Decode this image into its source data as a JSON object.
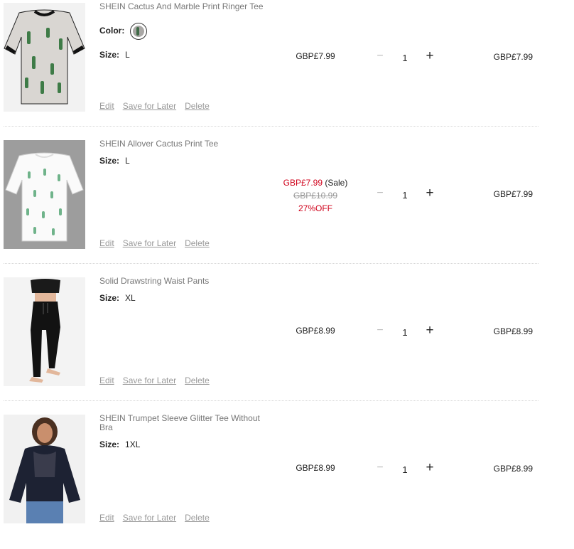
{
  "items": [
    {
      "title": "SHEIN Cactus And Marble Print Ringer Tee",
      "color_label": "Color:",
      "size_label": "Size:",
      "size_value": "L",
      "price": "GBP£7.99",
      "quantity": "1",
      "total": "GBP£7.99"
    },
    {
      "title": "SHEIN Allover Cactus Print Tee",
      "size_label": "Size:",
      "size_value": "L",
      "sale_price": "GBP£7.99",
      "sale_tag": "(Sale)",
      "original_price": "GBP£10.99",
      "discount": "27%OFF",
      "quantity": "1",
      "total": "GBP£7.99"
    },
    {
      "title": "Solid Drawstring Waist Pants",
      "size_label": "Size:",
      "size_value": "XL",
      "price": "GBP£8.99",
      "quantity": "1",
      "total": "GBP£8.99"
    },
    {
      "title": "SHEIN Trumpet Sleeve Glitter Tee Without Bra",
      "size_label": "Size:",
      "size_value": "1XL",
      "price": "GBP£8.99",
      "quantity": "1",
      "total": "GBP£8.99"
    }
  ],
  "actions": {
    "edit": "Edit",
    "save_for_later": "Save for Later",
    "delete": "Delete"
  },
  "qty_controls": {
    "minus": "−",
    "plus": "+"
  },
  "colors": {
    "sale": "#d0021b",
    "muted": "#999999",
    "text": "#222222"
  }
}
